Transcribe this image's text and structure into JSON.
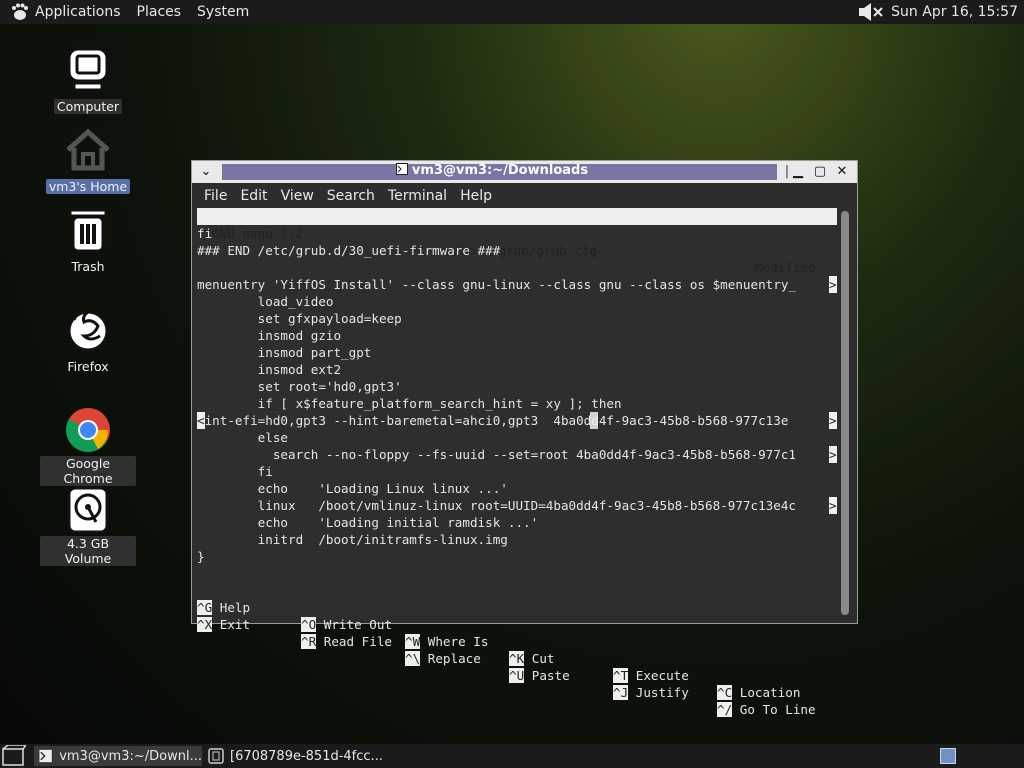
{
  "top_panel": {
    "applications": "Applications",
    "places": "Places",
    "system": "System",
    "clock": "Sun Apr 16, 15:57"
  },
  "desktop_icons": {
    "computer": "Computer",
    "home": "vm3's Home",
    "trash": "Trash",
    "firefox": "Firefox",
    "chrome": "Google Chrome",
    "volume": "4.3 GB Volume"
  },
  "window": {
    "title": "vm3@vm3:~/Downloads",
    "menu": [
      "File",
      "Edit",
      "View",
      "Search",
      "Terminal",
      "Help"
    ]
  },
  "nano": {
    "header_app": "GNU nano 7.2",
    "header_file": "/boot/grub/grub.cfg",
    "header_status": "Modified",
    "lines": [
      "fi",
      "### END /etc/grub.d/30_uefi-firmware ###",
      "",
      "menuentry 'YiffOS Install' --class gnu-linux --class gnu --class os $menuentry_",
      "        load_video",
      "        set gfxpayload=keep",
      "        insmod gzio",
      "        insmod part_gpt",
      "        insmod ext2",
      "        set root='hd0,gpt3'",
      "        if [ x$feature_platform_search_hint = xy ]; then",
      "hint-efi=hd0,gpt3 --hint-baremetal=ahci0,gpt3  4ba0dd4f-9ac3-45b8-b568-977c13e",
      "        else",
      "          search --no-floppy --fs-uuid --set=root 4ba0dd4f-9ac3-45b8-b568-977c1",
      "        fi",
      "        echo    'Loading Linux linux ...'",
      "        linux   /boot/vmlinuz-linux root=UUID=4ba0dd4f-9ac3-45b8-b568-977c13e4c",
      "        echo    'Loading initial ramdisk ...'",
      "        initrd  /boot/initramfs-linux.img",
      "}"
    ],
    "shortcuts_row1": [
      {
        "key": "^G",
        "label": "Help"
      },
      {
        "key": "^O",
        "label": "Write Out"
      },
      {
        "key": "^W",
        "label": "Where Is"
      },
      {
        "key": "^K",
        "label": "Cut"
      },
      {
        "key": "^T",
        "label": "Execute"
      },
      {
        "key": "^C",
        "label": "Location"
      }
    ],
    "shortcuts_row2": [
      {
        "key": "^X",
        "label": "Exit"
      },
      {
        "key": "^R",
        "label": "Read File"
      },
      {
        "key": "^\\",
        "label": "Replace"
      },
      {
        "key": "^U",
        "label": "Paste"
      },
      {
        "key": "^J",
        "label": "Justify"
      },
      {
        "key": "^/",
        "label": "Go To Line"
      }
    ]
  },
  "taskbar": {
    "task1": "vm3@vm3:~/Downl...",
    "task2": "[6708789e-851d-4fcc..."
  },
  "colors": {
    "panel": "#1b1b1b",
    "title_active": "#7876a3",
    "terminal_bg": "#2e2e2e"
  }
}
